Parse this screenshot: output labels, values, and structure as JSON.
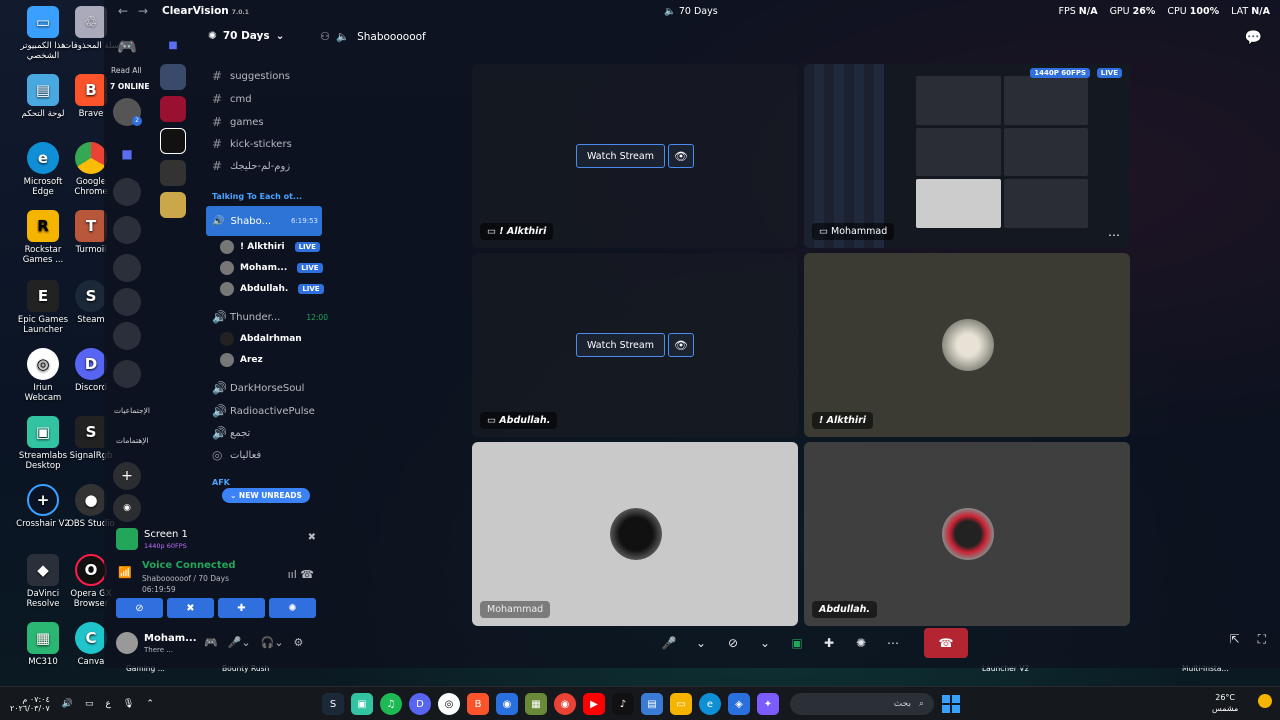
{
  "window": {
    "brand": "ClearVision",
    "brand_version": "7.0.1",
    "center_title": "70 Days",
    "stats": {
      "fps_label": "FPS",
      "fps": "N/A",
      "gpu_label": "GPU",
      "gpu": "26%",
      "cpu_label": "CPU",
      "cpu": "100%",
      "lat_label": "LAT",
      "lat": "N/A"
    }
  },
  "desktop_icons": [
    "هذا الكمبيوتر الشخصي",
    "سلة المحذوفات",
    "لوحة التحكم",
    "Brave",
    "Microsoft Edge",
    "Google Chrome",
    "Rockstar Games ...",
    "Turmoil",
    "Epic Games Launcher",
    "Steam",
    "Iriun Webcam",
    "Discord",
    "Streamlabs Desktop",
    "SignalRgb",
    "Crosshair V2",
    "OBS Studio",
    "DaVinci Resolve",
    "Opera GX Browser",
    "MC310",
    "Canva"
  ],
  "rail": {
    "read_all": "Read All",
    "online": "7 ONLINE",
    "badge_count": "2",
    "label_1": "الإجتماعيات",
    "label_2": "الإهتمامات"
  },
  "guild": {
    "name": "70 Days",
    "text_channels": [
      "suggestions",
      "cmd",
      "games",
      "kick-stickers",
      "زوم-لم-حليجك"
    ],
    "category": "Talking To Each ot...",
    "active_voice": {
      "name": "Shabo...",
      "time": "6:19:53"
    },
    "voice_members": [
      {
        "name": "! Alkthiri",
        "live": "LIVE"
      },
      {
        "name": "Moham...",
        "live": "LIVE"
      },
      {
        "name": "Abdullah.",
        "live": "LIVE"
      }
    ],
    "voice_2": {
      "name": "Thunder...",
      "time": "12:00"
    },
    "voice_2_members": [
      "Abdalrhman",
      "Arez"
    ],
    "other_voice": [
      "DarkHorseSoul",
      "RadioactivePulse",
      "تجمع",
      "فعاليات"
    ],
    "afk_label": "AFK",
    "new_unreads": "NEW UNREADS"
  },
  "screen_panel": {
    "title": "Screen 1",
    "quality": "1440p 60FPS"
  },
  "voice_panel": {
    "status": "Voice Connected",
    "location": "Shaboooooof / 70 Days",
    "duration": "06:19:59"
  },
  "user_panel": {
    "name": "Moham...",
    "status": "There ..."
  },
  "voice_header": {
    "channel": "Shaboooooof"
  },
  "tiles": {
    "watch_label": "Watch Stream",
    "t1_name": "! Alkthiri",
    "t2_name": "Mohammad",
    "t2_quality": "1440P 60FPS",
    "t2_live": "LIVE",
    "t3_name": "Abdullah.",
    "t4_name": "! Alkthiri",
    "t5_name": "Mohammad",
    "t6_name": "Abdullah."
  },
  "under_labels": [
    "Gaming ...",
    "Bounty Rush",
    "Launcher V2",
    "Multi-Insta..."
  ],
  "taskbar": {
    "time": "٠٧:٠٤ م",
    "date": "٢٠٢٦/٠٣/٠٧",
    "lang": "ع",
    "search_placeholder": "بحث",
    "temp": "26°C",
    "weather": "مشمس"
  },
  "colors": {
    "accent": "#2f6fde",
    "live": "#2f6fde",
    "hangup": "#b42532",
    "green": "#23a55a"
  }
}
